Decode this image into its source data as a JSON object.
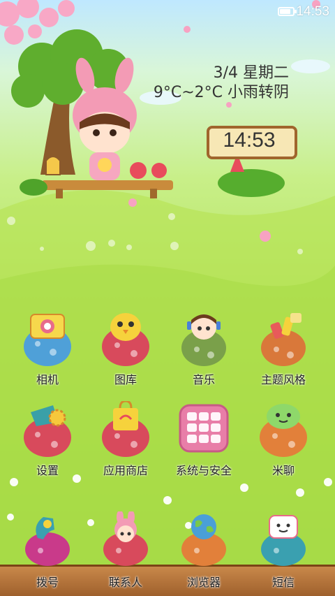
{
  "status_bar": {
    "time": "14:53",
    "battery_level": 0.85
  },
  "weather": {
    "date": "3/4 星期二",
    "temperature": "9°C~2°C 小雨转阴"
  },
  "clock": {
    "time": "14:53"
  },
  "apps_row1": [
    {
      "label": "相机",
      "icon": "camera-icon",
      "color": "#4fa0d8"
    },
    {
      "label": "图库",
      "icon": "gallery-chick-icon",
      "color": "#d84a5c"
    },
    {
      "label": "音乐",
      "icon": "music-girl-icon",
      "color": "#7aa04a"
    },
    {
      "label": "主题风格",
      "icon": "paint-theme-icon",
      "color": "#d9783a"
    }
  ],
  "apps_row2": [
    {
      "label": "设置",
      "icon": "gear-settings-icon",
      "color": "#d84a5c"
    },
    {
      "label": "应用商店",
      "icon": "shopping-bag-icon",
      "color": "#d84a5c"
    },
    {
      "label": "系统与安全",
      "icon": "grid-security-icon",
      "color": "#e87ea8"
    },
    {
      "label": "米聊",
      "icon": "chat-bubble-icon",
      "color": "#e2803a"
    }
  ],
  "dock": [
    {
      "label": "拨号",
      "icon": "phone-dialer-icon",
      "color": "#c93a8a"
    },
    {
      "label": "联系人",
      "icon": "contacts-bunny-icon",
      "color": "#d84a5c"
    },
    {
      "label": "浏览器",
      "icon": "globe-browser-icon",
      "color": "#e2803a"
    },
    {
      "label": "短信",
      "icon": "message-icon",
      "color": "#3aa0b0"
    }
  ]
}
